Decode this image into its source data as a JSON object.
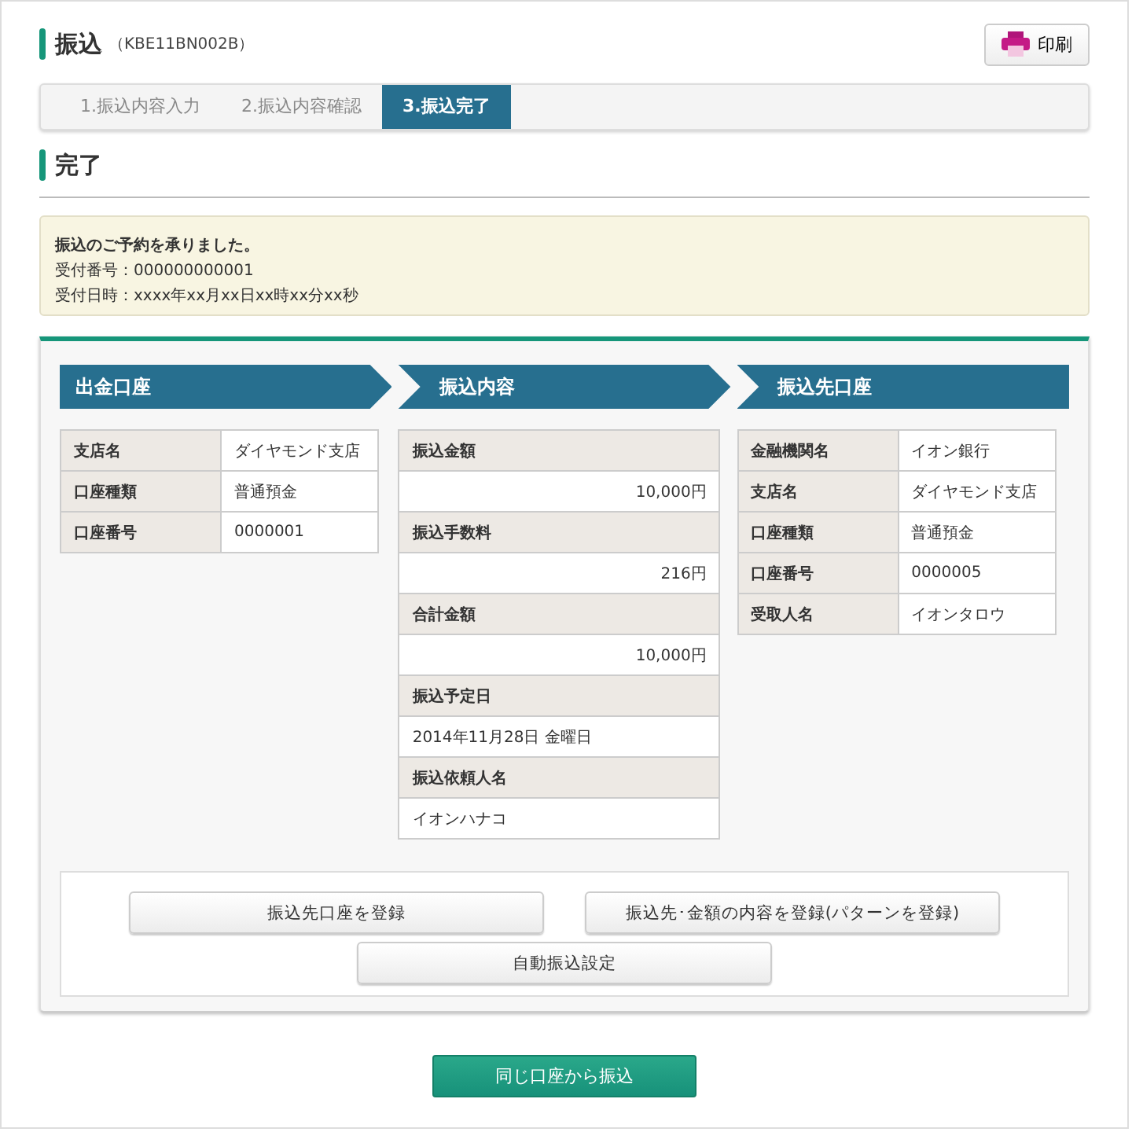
{
  "header": {
    "title": "振込",
    "code": "（KBE11BN002B）",
    "print_button": "印刷"
  },
  "steps": [
    {
      "label": "1.振込内容入力",
      "selected": false
    },
    {
      "label": "2.振込内容確認",
      "selected": false
    },
    {
      "label": "3.振込完了",
      "selected": true
    }
  ],
  "section_title": "完了",
  "notice": {
    "message": "振込のご予約を承りました。",
    "lines": [
      "受付番号：000000000001",
      "受付日時：xxxx年xx月xx日xx時xx分xx秒"
    ]
  },
  "panels": [
    {
      "title": "出金口座",
      "kind": "pairs",
      "rows": [
        {
          "label": "支店名",
          "value": "ダイヤモンド支店",
          "kind": "text"
        },
        {
          "label": "口座種類",
          "value": "普通預金",
          "kind": "text"
        },
        {
          "label": "口座番号",
          "value": "0000001",
          "kind": "text"
        }
      ]
    },
    {
      "title": "振込内容",
      "kind": "stacked",
      "rows": [
        {
          "label": "振込金額",
          "value": "10,000円",
          "kind": "amount"
        },
        {
          "label": "振込手数料",
          "value": "216円",
          "kind": "amount"
        },
        {
          "label": "合計金額",
          "value": "10,000円",
          "kind": "amount"
        },
        {
          "label": "振込予定日",
          "value": "2014年11月28日 金曜日",
          "kind": "text"
        },
        {
          "label": "振込依頼人名",
          "value": "イオンハナコ",
          "kind": "text"
        }
      ]
    },
    {
      "title": "振込先口座",
      "kind": "pairs",
      "rows": [
        {
          "label": "金融機関名",
          "value": "イオン銀行",
          "kind": "text"
        },
        {
          "label": "支店名",
          "value": "ダイヤモンド支店",
          "kind": "text"
        },
        {
          "label": "口座種類",
          "value": "普通預金",
          "kind": "text"
        },
        {
          "label": "口座番号",
          "value": "0000005",
          "kind": "text"
        },
        {
          "label": "受取人名",
          "value": "イオンタロウ",
          "kind": "text"
        }
      ]
    }
  ],
  "actions": [
    "振込先口座を登録",
    "振込先･金額の内容を登録(パターンを登録)",
    "自動振込設定"
  ],
  "primary_button": "同じ口座から振込"
}
